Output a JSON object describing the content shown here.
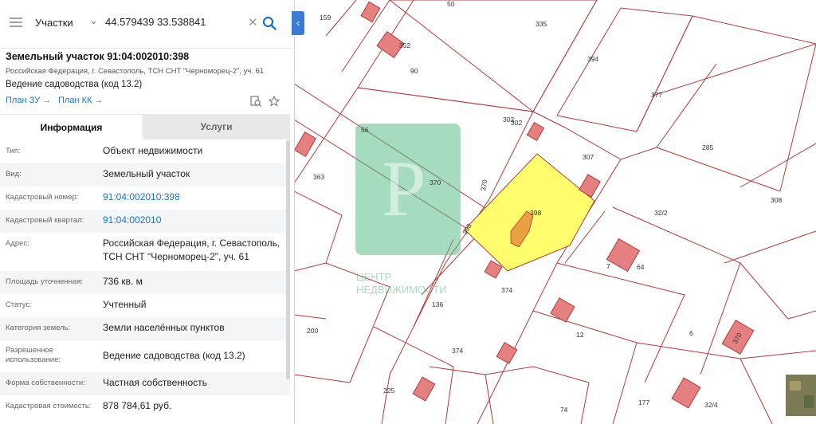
{
  "search": {
    "category": "Участки",
    "query": "44.579439 33.538841"
  },
  "parcel": {
    "title": "Земельный участок 91:04:002010:398",
    "address_short": "Российская Федерация, г. Севастополь, ТСН СНТ \"Черноморец-2\", уч. 61",
    "use": "Ведение садоводства (код 13.2)",
    "links": [
      "План ЗУ →",
      "План КК →"
    ]
  },
  "tabs": [
    "Информация",
    "Услуги"
  ],
  "info": [
    {
      "label": "Тип:",
      "value": "Объект недвижимости"
    },
    {
      "label": "Вид:",
      "value": "Земельный участок"
    },
    {
      "label": "Кадастровый номер:",
      "value": "91:04:002010:398",
      "link": true
    },
    {
      "label": "Кадастровый квартал:",
      "value": "91:04:002010",
      "link": true
    },
    {
      "label": "Адрес:",
      "value": "Российская Федерация, г. Севастополь, ТСН СНТ \"Черноморец-2\", уч. 61"
    },
    {
      "label": "Площадь уточненная:",
      "value": "736 кв. м"
    },
    {
      "label": "Статус:",
      "value": "Учтенный"
    },
    {
      "label": "Категория земель:",
      "value": "Земли населённых пунктов"
    },
    {
      "label": "Разрешенное использование:",
      "value": "Ведение садоводства (код 13.2)"
    },
    {
      "label": "Форма собственности:",
      "value": "Частная собственность"
    },
    {
      "label": "Кадастровая стоимость:",
      "value": "878 784,61 руб."
    }
  ],
  "map": {
    "parcel_labels": [
      "159",
      "50",
      "335",
      "352",
      "90",
      "394",
      "377",
      "302",
      "302",
      "307",
      "56",
      "363",
      "370",
      "370",
      "398",
      "398",
      "285",
      "308",
      "32/2",
      "64",
      "7",
      "374",
      "136",
      "200",
      "374",
      "6",
      "12",
      "370",
      "225",
      "74",
      "177",
      "32/4"
    ],
    "watermark": [
      "ЦЕНТР",
      "НЕДВИЖИМОСТИ"
    ]
  },
  "colors": {
    "accent": "#1a73c8",
    "parcel_line": "#b53a3a",
    "selected": "#ffff6e",
    "building": "#e48080",
    "watermark": "#5bbf8a"
  }
}
